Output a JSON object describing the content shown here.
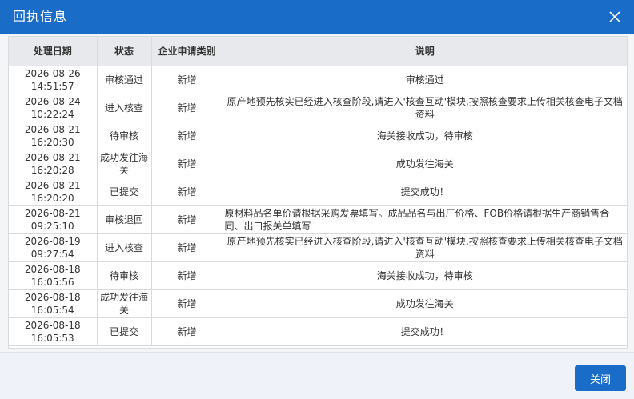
{
  "dialog": {
    "title": "回执信息",
    "close_button_label": "关闭",
    "accent_color": "#1a6cc9"
  },
  "table": {
    "headers": [
      "处理日期",
      "状态",
      "企业申请类别",
      "说明"
    ],
    "rows": [
      {
        "date": "2026-08-26",
        "time": "14:51:57",
        "status": "审核通过",
        "category": "新增",
        "note": "审核通过",
        "align": "center"
      },
      {
        "date": "2026-08-24",
        "time": "10:22:24",
        "status": "进入核查",
        "category": "新增",
        "note": "原产地预先核实已经进入核查阶段,请进入'核查互动'模块,按照核查要求上传相关核查电子文档资料",
        "align": "center"
      },
      {
        "date": "2026-08-21",
        "time": "16:20:30",
        "status": "待审核",
        "category": "新增",
        "note": "海关接收成功，待审核",
        "align": "center"
      },
      {
        "date": "2026-08-21",
        "time": "16:20:28",
        "status": "成功发往海关",
        "category": "新增",
        "note": "成功发往海关",
        "align": "center"
      },
      {
        "date": "2026-08-21",
        "time": "16:20:20",
        "status": "已提交",
        "category": "新增",
        "note": "提交成功！",
        "align": "center"
      },
      {
        "date": "2026-08-21",
        "time": "09:25:10",
        "status": "审核退回",
        "category": "新增",
        "note": "原材料品名单价请根据采购发票填写。成品品名与出厂价格、FOB价格请根据生产商销售合同、出口报关单填写",
        "align": "left"
      },
      {
        "date": "2026-08-19",
        "time": "09:27:54",
        "status": "进入核查",
        "category": "新增",
        "note": "原产地预先核实已经进入核查阶段,请进入'核查互动'模块,按照核查要求上传相关核查电子文档资料",
        "align": "center"
      },
      {
        "date": "2026-08-18",
        "time": "16:05:56",
        "status": "待审核",
        "category": "新增",
        "note": "海关接收成功，待审核",
        "align": "center"
      },
      {
        "date": "2026-08-18",
        "time": "16:05:54",
        "status": "成功发往海关",
        "category": "新增",
        "note": "成功发往海关",
        "align": "center"
      },
      {
        "date": "2026-08-18",
        "time": "16:05:53",
        "status": "已提交",
        "category": "新增",
        "note": "提交成功！",
        "align": "center"
      }
    ]
  }
}
